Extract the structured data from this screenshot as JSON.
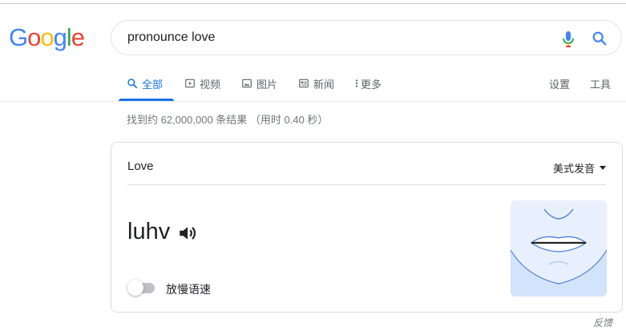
{
  "logo": {
    "letters": [
      "G",
      "o",
      "o",
      "g",
      "l",
      "e"
    ],
    "colors": [
      "#4285f4",
      "#ea4335",
      "#fbbc05",
      "#4285f4",
      "#34a853",
      "#ea4335"
    ]
  },
  "search": {
    "value": "pronounce love",
    "mic_icon": "mic-icon",
    "search_icon": "search-icon"
  },
  "tabs": {
    "items": [
      {
        "label": "全部",
        "icon": "search-icon",
        "active": true
      },
      {
        "label": "视频",
        "icon": "play-icon",
        "active": false
      },
      {
        "label": "图片",
        "icon": "image-icon",
        "active": false
      },
      {
        "label": "新闻",
        "icon": "news-icon",
        "active": false
      },
      {
        "label": "更多",
        "icon": "more-vertical-icon",
        "active": false
      }
    ],
    "settings": "设置",
    "tools": "工具"
  },
  "result_stats": "找到约 62,000,000 条结果 （用时 0.40 秒）",
  "card": {
    "word": "Love",
    "dialect": "美式发音",
    "phonetic": "luhv",
    "slow_toggle_label": "放慢语速",
    "slow_toggle_on": false
  },
  "feedback": "反馈",
  "colors": {
    "accent": "#1a73e8",
    "muted": "#5f6368",
    "illustration_bg": "#e8f0fe",
    "illustration_line": "#4d7fd6"
  }
}
